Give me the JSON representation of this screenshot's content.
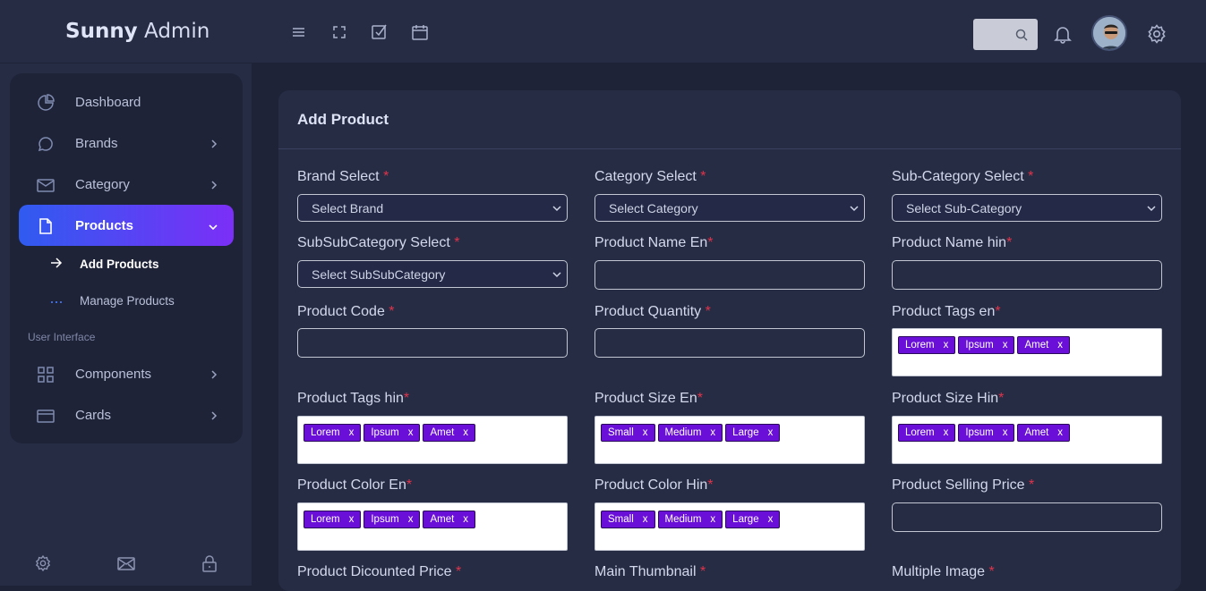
{
  "header": {
    "brand_bold": "Sunny",
    "brand_rest": "Admin",
    "icons": [
      "menu-icon",
      "fullscreen-icon",
      "checkbox-icon",
      "calendar-icon",
      "search-icon",
      "bell-icon",
      "avatar",
      "gear-icon"
    ]
  },
  "sidebar": {
    "items": [
      {
        "label": "Dashboard",
        "icon": "pie-chart-icon"
      },
      {
        "label": "Brands",
        "icon": "chat-icon"
      },
      {
        "label": "Category",
        "icon": "mail-icon"
      },
      {
        "label": "Products",
        "icon": "file-icon"
      }
    ],
    "sub_items": [
      {
        "label": "Add Products"
      },
      {
        "label": "Manage Products"
      }
    ],
    "section_label": "User Interface",
    "ui_items": [
      {
        "label": "Components",
        "icon": "grid-icon"
      },
      {
        "label": "Cards",
        "icon": "card-icon"
      }
    ],
    "footer_icons": [
      "settings-icon",
      "mail-icon",
      "lock-icon"
    ]
  },
  "form": {
    "title": "Add Product",
    "brand_label": "Brand Select",
    "brand_placeholder": "Select Brand",
    "category_label": "Category Select",
    "category_placeholder": "Select Category",
    "subcategory_label": "Sub-Category Select",
    "subcategory_placeholder": "Select Sub-Category",
    "subsub_label": "SubSubCategory Select",
    "subsub_placeholder": "Select SubSubCategory",
    "name_en_label": "Product Name En",
    "name_hin_label": "Product Name hin",
    "code_label": "Product Code",
    "quantity_label": "Product Quantity",
    "tags_en_label": "Product Tags en",
    "tags_en": [
      "Lorem",
      "Ipsum",
      "Amet"
    ],
    "tags_hin_label": "Product Tags hin",
    "tags_hin": [
      "Lorem",
      "Ipsum",
      "Amet"
    ],
    "size_en_label": "Product Size En",
    "size_en": [
      "Small",
      "Medium",
      "Large"
    ],
    "size_hin_label": "Product Size Hin",
    "size_hin": [
      "Lorem",
      "Ipsum",
      "Amet"
    ],
    "color_en_label": "Product Color En",
    "color_en": [
      "Lorem",
      "Ipsum",
      "Amet"
    ],
    "color_hin_label": "Product Color Hin",
    "color_hin": [
      "Small",
      "Medium",
      "Large"
    ],
    "selling_label": "Product Selling Price",
    "discount_label": "Product Dicounted Price",
    "thumbnail_label": "Main Thumbnail",
    "multi_image_label": "Multiple Image",
    "required_mark": "*",
    "tag_remove": "x"
  },
  "colors": {
    "accent_start": "#2f5bf0",
    "accent_end": "#7b2ff7",
    "tag": "#6a0fd8",
    "required": "#e0344b"
  }
}
